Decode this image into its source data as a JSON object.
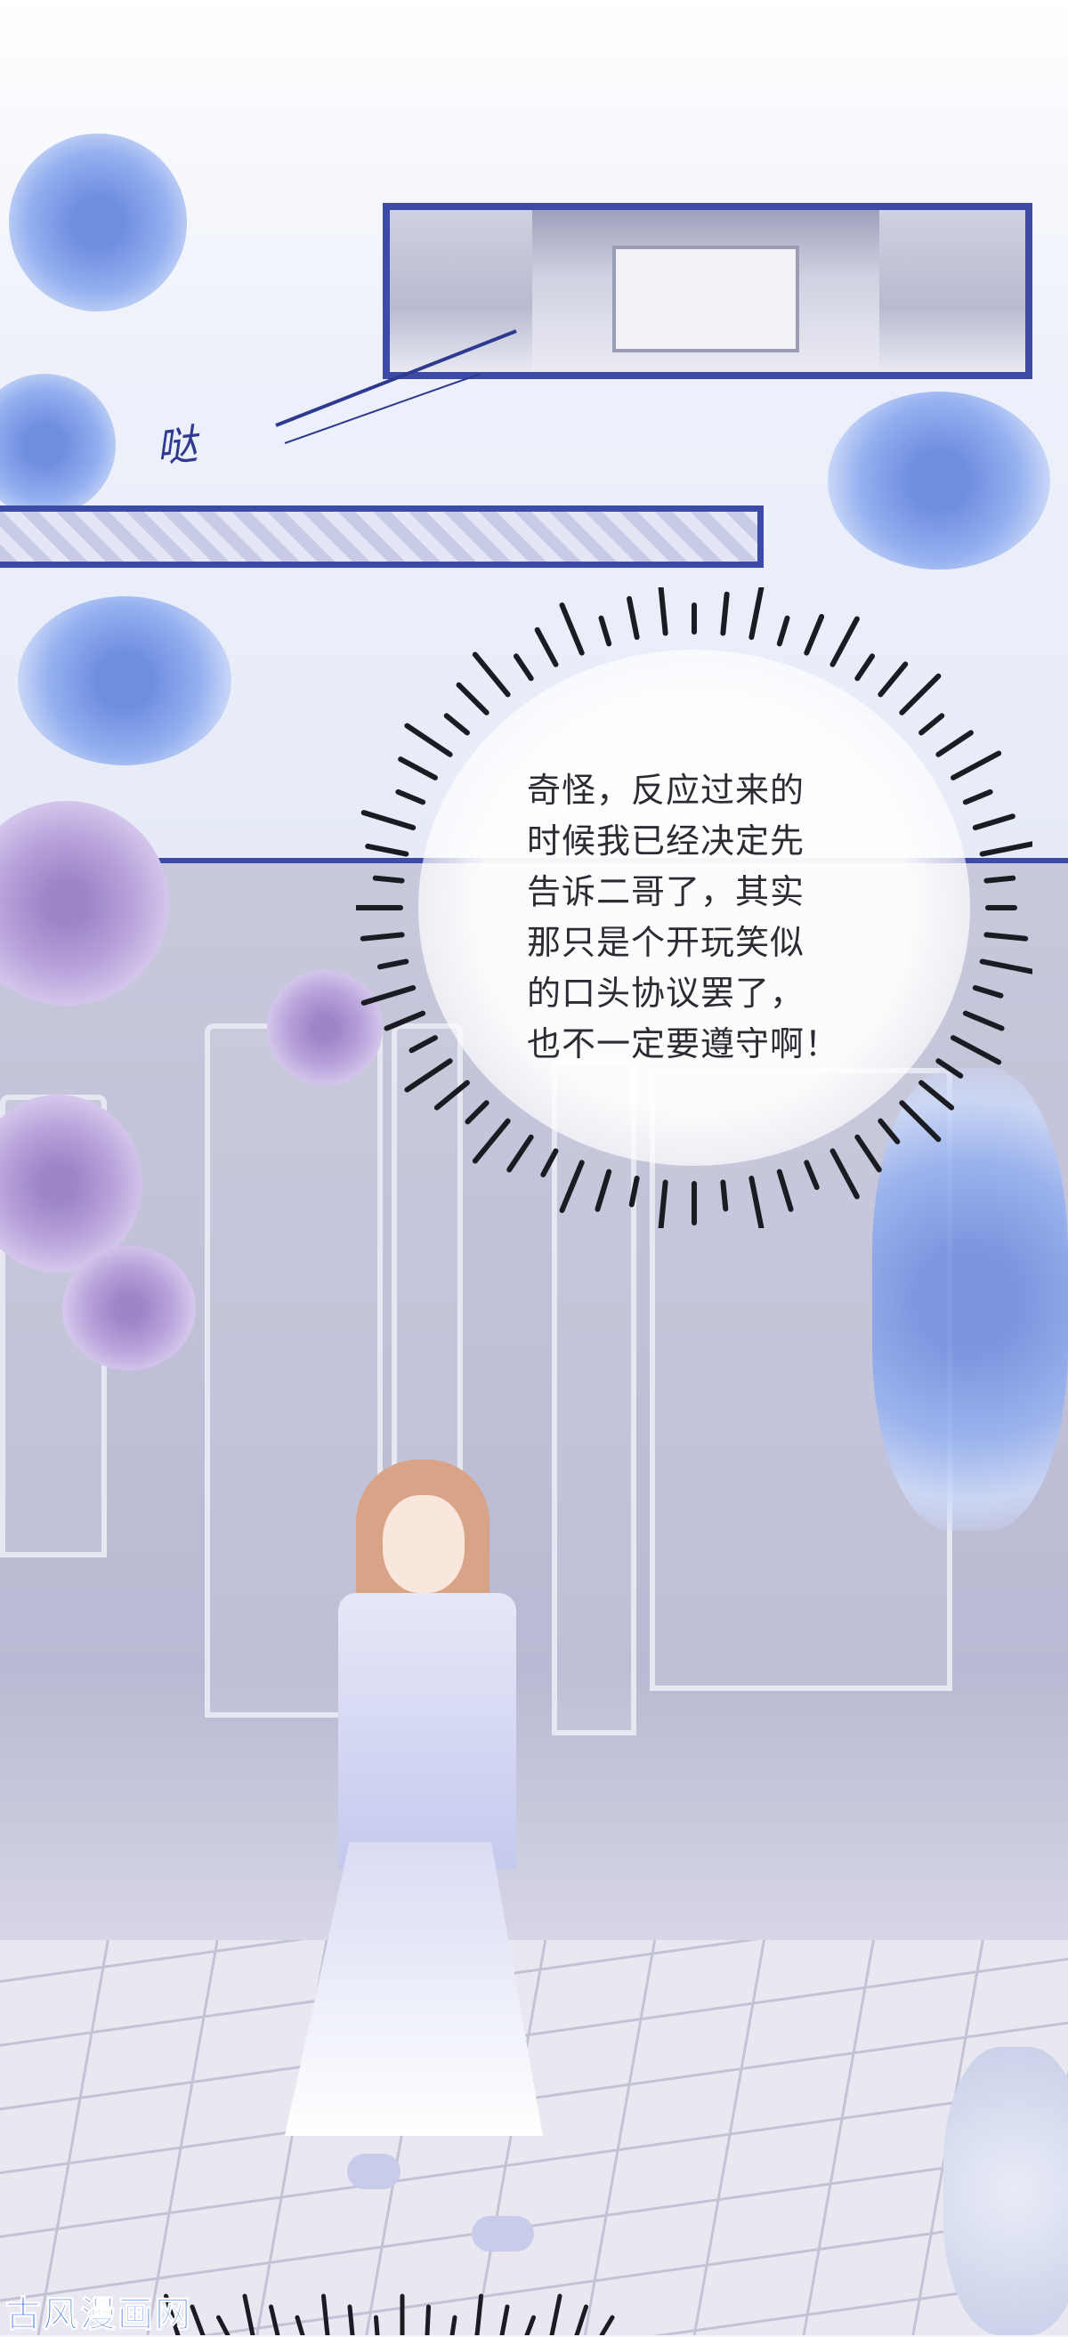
{
  "comic": {
    "sound_effect": "哒",
    "dialogue": "奇怪，反应过来的\n时候我已经决定先\n告诉二哥了，其实\n那只是个开玩笑似\n的口头协议罢了，\n也不一定要遵守啊！",
    "watermark": "古风漫画网"
  },
  "colors": {
    "panel_border": "#3d4aa6",
    "watermark": "#2f6be0"
  },
  "icons": [
    "blue-flower-icon",
    "purple-rose-icon",
    "white-flower-icon"
  ]
}
